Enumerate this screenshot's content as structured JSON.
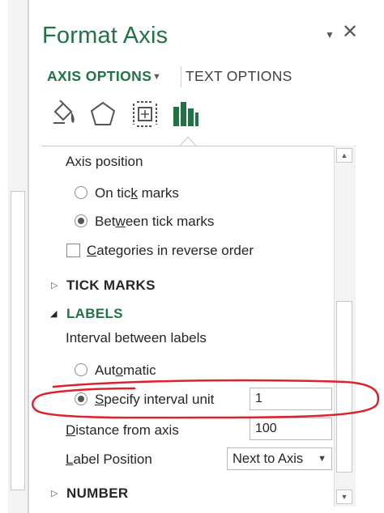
{
  "panel": {
    "title": "Format Axis",
    "close_glyph": "✕",
    "dropdown_glyph": "▼"
  },
  "tabs": {
    "axis_options": "AXIS OPTIONS",
    "text_options": "TEXT OPTIONS"
  },
  "icons": [
    "fill-line-icon",
    "effects-icon",
    "size-properties-icon",
    "axis-options-icon"
  ],
  "axis_position": {
    "heading": "Axis position",
    "on_tick_marks": {
      "pre": "On tic",
      "key": "k",
      "post": " marks",
      "selected": false
    },
    "between_tick_marks": {
      "pre": "Bet",
      "key": "w",
      "post": "een tick marks",
      "selected": true
    },
    "reverse_order": {
      "pre": "",
      "key": "C",
      "post": "ategories in reverse order",
      "checked": false
    }
  },
  "sections": {
    "tick_marks": "TICK MARKS",
    "labels": "LABELS",
    "number": "NUMBER"
  },
  "labels": {
    "interval_heading": "Interval between labels",
    "automatic": {
      "pre": "Aut",
      "key": "o",
      "post": "matic",
      "selected": false
    },
    "specify": {
      "pre": "",
      "key": "S",
      "post": "pecify interval unit",
      "selected": true,
      "value": "1"
    },
    "distance": {
      "pre": "",
      "key": "D",
      "post": "istance from axis",
      "value": "100"
    },
    "position": {
      "pre": "",
      "key": "L",
      "post": "abel Position",
      "value": "Next to Axis"
    }
  },
  "colors": {
    "accent": "#217346",
    "annotation": "#e0202a"
  }
}
